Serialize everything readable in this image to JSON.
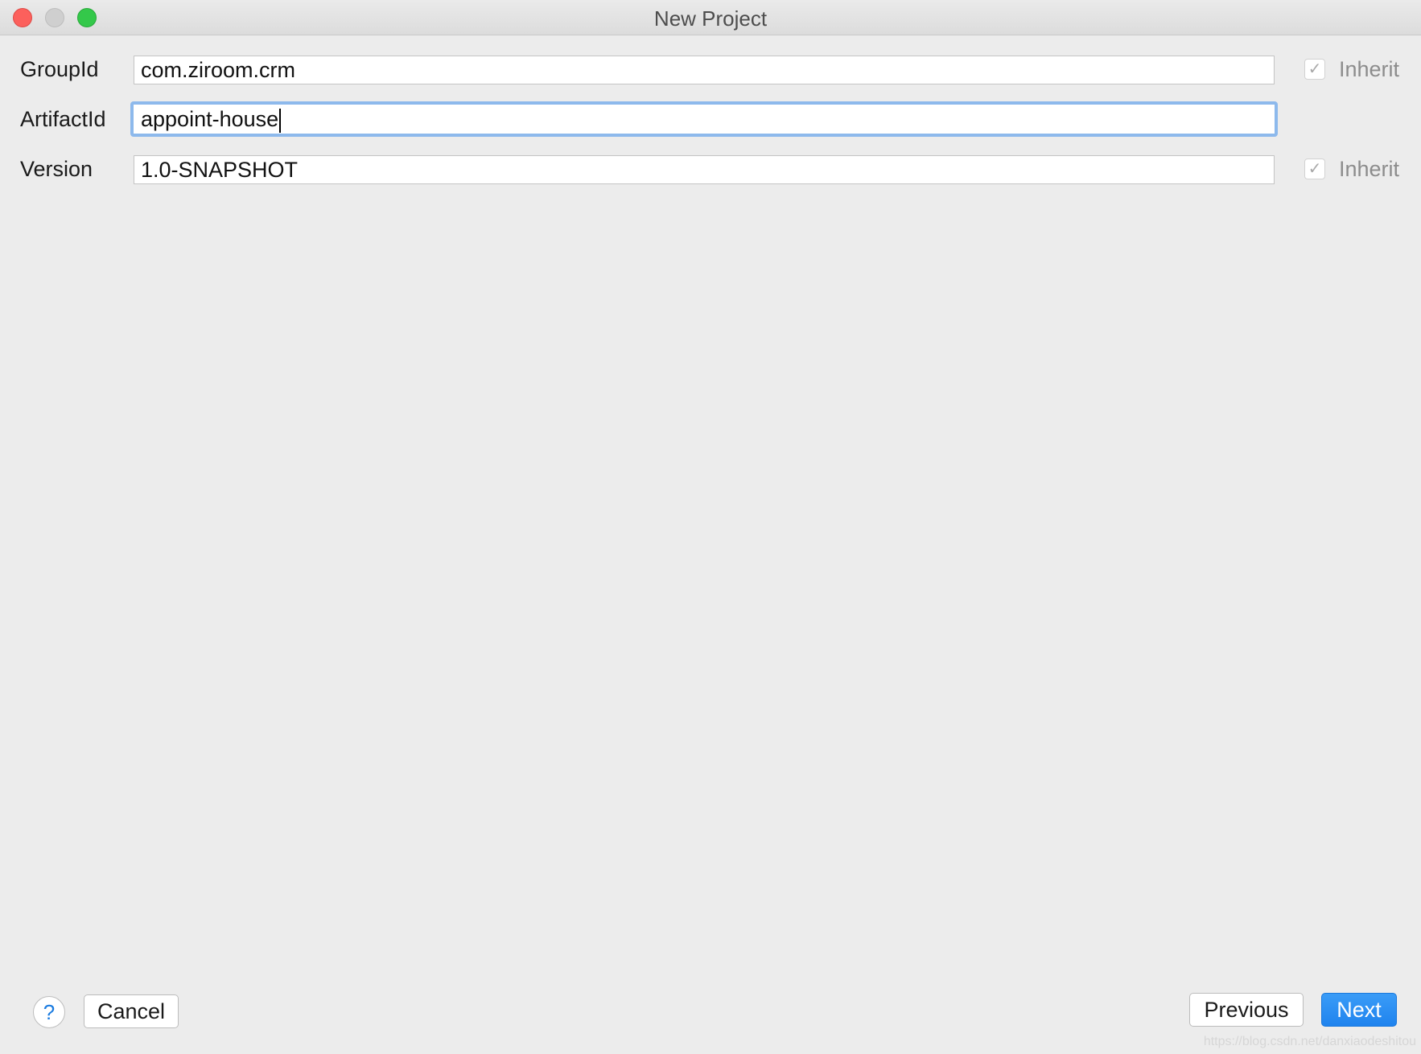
{
  "window": {
    "title": "New Project"
  },
  "form": {
    "group_id": {
      "label": "GroupId",
      "value": "com.ziroom.crm",
      "inherit_label": "Inherit",
      "inherit_checked": true
    },
    "artifact_id": {
      "label": "ArtifactId",
      "value": "appoint-house"
    },
    "version": {
      "label": "Version",
      "value": "1.0-SNAPSHOT",
      "inherit_label": "Inherit",
      "inherit_checked": true
    }
  },
  "buttons": {
    "help": "?",
    "cancel": "Cancel",
    "previous": "Previous",
    "next": "Next"
  },
  "icons": {
    "checkmark": "✓"
  },
  "watermark": "https://blog.csdn.net/danxiaodeshitou",
  "colors": {
    "accent": "#1f83ee",
    "focus_ring": "#8db9ec",
    "close": "#fc605c",
    "zoom": "#34c84a"
  }
}
